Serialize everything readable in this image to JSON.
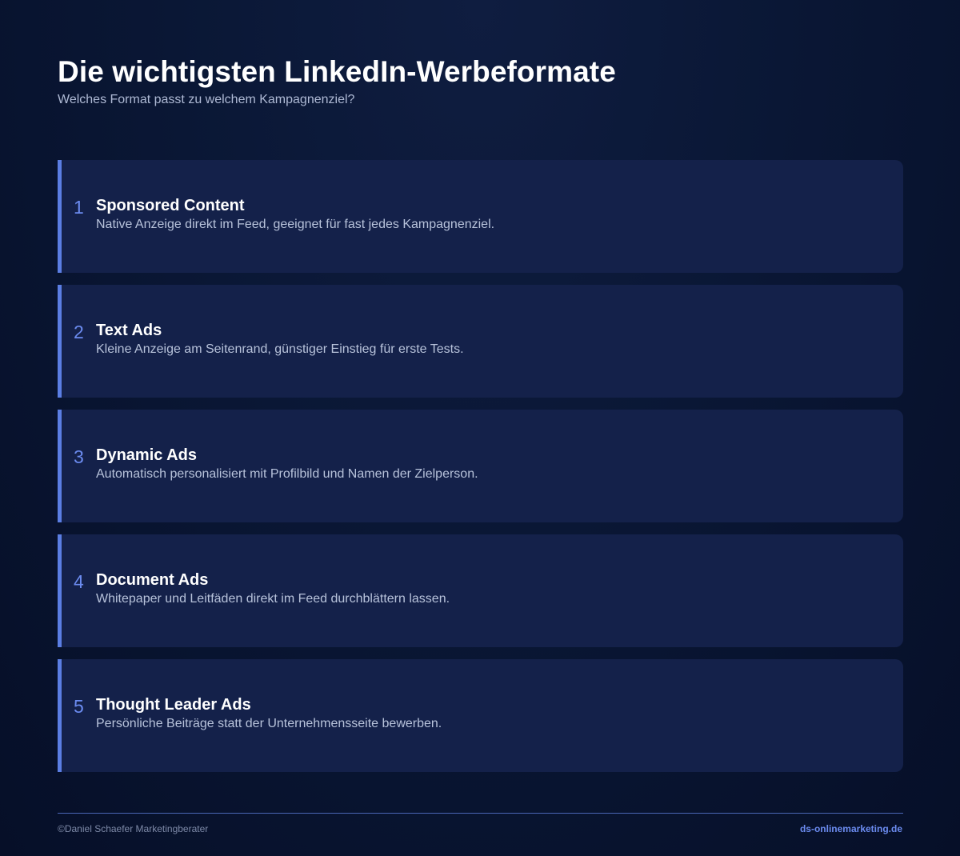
{
  "header": {
    "title": "Die wichtigsten LinkedIn-Werbeformate",
    "subtitle": "Welches Format passt zu welchem Kampagnenziel?"
  },
  "formats": [
    {
      "number": "1",
      "title": "Sponsored Content",
      "description": "Native Anzeige direkt im Feed, geeignet für fast jedes Kampagnenziel."
    },
    {
      "number": "2",
      "title": "Text Ads",
      "description": "Kleine Anzeige am Seitenrand, günstiger Einstieg für erste Tests."
    },
    {
      "number": "3",
      "title": "Dynamic Ads",
      "description": "Automatisch personalisiert mit Profilbild und Namen der Zielperson."
    },
    {
      "number": "4",
      "title": "Document Ads",
      "description": "Whitepaper und Leitfäden direkt im Feed durchblättern lassen."
    },
    {
      "number": "5",
      "title": "Thought Leader Ads",
      "description": "Persönliche Beiträge statt der Unternehmensseite bewerben."
    }
  ],
  "footer": {
    "copyright": "©Daniel Schaefer Marketingberater",
    "website": "ds-onlinemarketing.de"
  },
  "colors": {
    "background": "#0a1735",
    "card": "#14214a",
    "accent": "#5b7ee3",
    "number": "#6b8bef"
  }
}
